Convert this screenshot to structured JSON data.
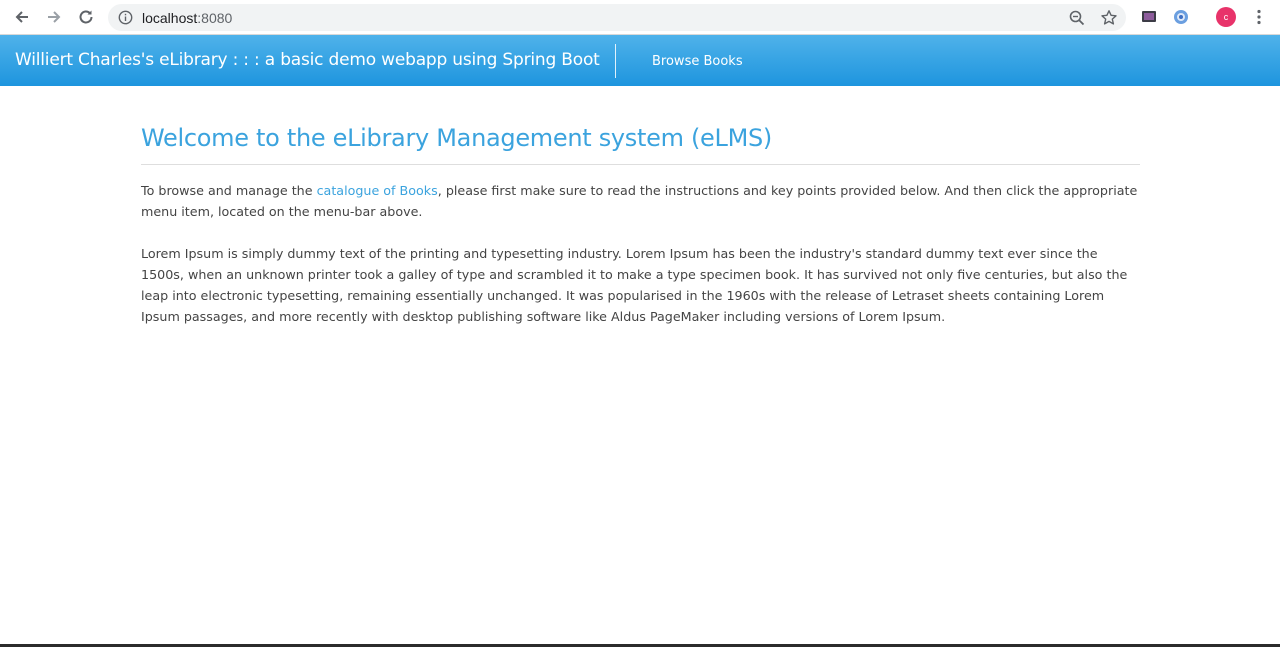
{
  "browser": {
    "url_host": "localhost",
    "url_port": ":8080",
    "profile_initial": "c",
    "icons": {
      "back": "arrow-left-icon",
      "forward": "arrow-right-icon",
      "reload": "reload-icon",
      "info": "info-icon",
      "zoom": "zoom-icon",
      "bookmark": "star-icon",
      "menu": "kebab-menu-icon"
    }
  },
  "navbar": {
    "brand": "Williert Charles's eLibrary : : : a basic demo webapp using Spring Boot",
    "links": [
      "Browse Books"
    ],
    "colors": {
      "top": "#4fb2ea",
      "bottom": "#1e95de"
    }
  },
  "main": {
    "title": "Welcome to the eLibrary Management system (eLMS)",
    "intro_before": "To browse and manage the ",
    "intro_link": "catalogue of Books",
    "intro_after": ", please first make sure to read the instructions and key points provided below. And then click the appropriate menu item, located on the menu-bar above.",
    "lorem": "Lorem Ipsum is simply dummy text of the printing and typesetting industry. Lorem Ipsum has been the industry's standard dummy text ever since the 1500s, when an unknown printer took a galley of type and scrambled it to make a type specimen book. It has survived not only five centuries, but also the leap into electronic typesetting, remaining essentially unchanged. It was popularised in the 1960s with the release of Letraset sheets containing Lorem Ipsum passages, and more recently with desktop publishing software like Aldus PageMaker including versions of Lorem Ipsum.",
    "accent_color": "#3ba3de"
  }
}
